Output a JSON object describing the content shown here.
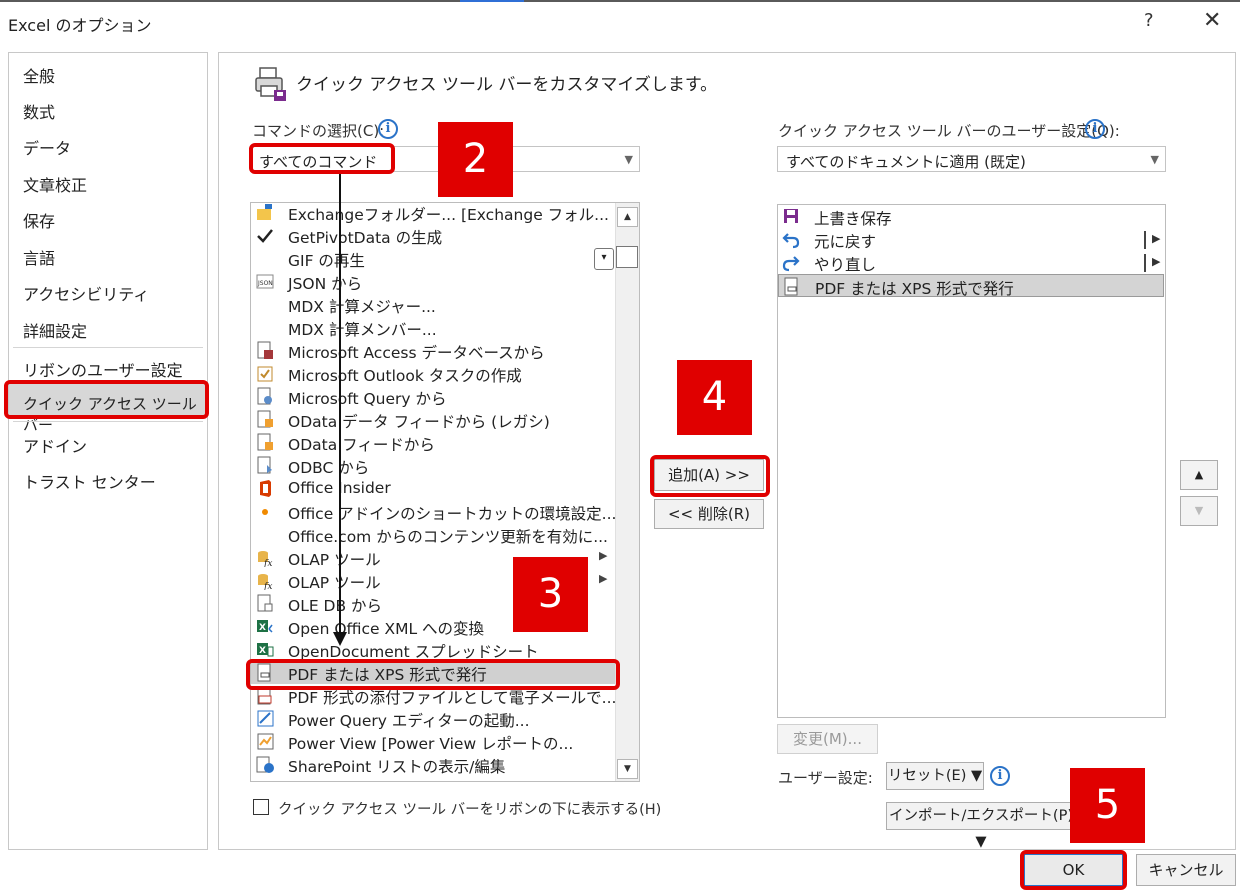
{
  "window": {
    "title": "Excel のオプション",
    "help": "?",
    "close": "✕"
  },
  "nav": {
    "items": [
      "全般",
      "数式",
      "データ",
      "文章校正",
      "保存",
      "言語",
      "アクセシビリティ",
      "詳細設定",
      "リボンのユーザー設定",
      "クイック アクセス ツール バー",
      "アドイン",
      "トラスト センター"
    ],
    "selected_index": 9
  },
  "heading": "クイック アクセス ツール バーをカスタマイズします。",
  "choose": {
    "label": "コマンドの選択(C):",
    "value": "すべてのコマンド"
  },
  "customize": {
    "label": "クイック アクセス ツール バーのユーザー設定(Q):",
    "value": "すべてのドキュメントに適用 (既定)"
  },
  "commands": [
    "Exchangeフォルダー... [Exchange フォル...",
    "GetPivotData の生成",
    "GIF の再生",
    "JSON から",
    "MDX 計算メジャー...",
    "MDX 計算メンバー...",
    "Microsoft Access データベースから",
    "Microsoft Outlook タスクの作成",
    "Microsoft Query から",
    "OData データ フィードから (レガシ)",
    "OData フィードから",
    "ODBC から",
    "Office Insider",
    "Office アドインのショートカットの環境設定...",
    "Office.com からのコンテンツ更新を有効に...",
    "OLAP ツール",
    "OLAP ツール",
    "OLE DB から",
    "Open Office XML への変換",
    "OpenDocument スプレッドシート",
    "PDF または XPS 形式で発行",
    "PDF 形式の添付ファイルとして電子メールで...",
    "Power Query エディターの起動...",
    "Power View [Power View レポートの...",
    "SharePoint リストの表示/編集"
  ],
  "commands_selected_index": 20,
  "qat_items": [
    "上書き保存",
    "元に戻す",
    "やり直し",
    "PDF または XPS 形式で発行"
  ],
  "qat_selected_index": 3,
  "buttons": {
    "add": "追加(A) >>",
    "remove": "<< 削除(R)",
    "modify": "変更(M)...",
    "reset": "リセット(E) ▼",
    "import_export": "インポート/エクスポート(P) ▼",
    "ok": "OK",
    "cancel": "キャンセル"
  },
  "user_settings_label": "ユーザー設定:",
  "show_below_ribbon": "クイック アクセス ツール バーをリボンの下に表示する(H)",
  "step_labels": {
    "s2": "2",
    "s3": "3",
    "s4": "4",
    "s5": "5"
  },
  "colors": {
    "highlight": "#e00000",
    "accent": "#2b73c8"
  }
}
